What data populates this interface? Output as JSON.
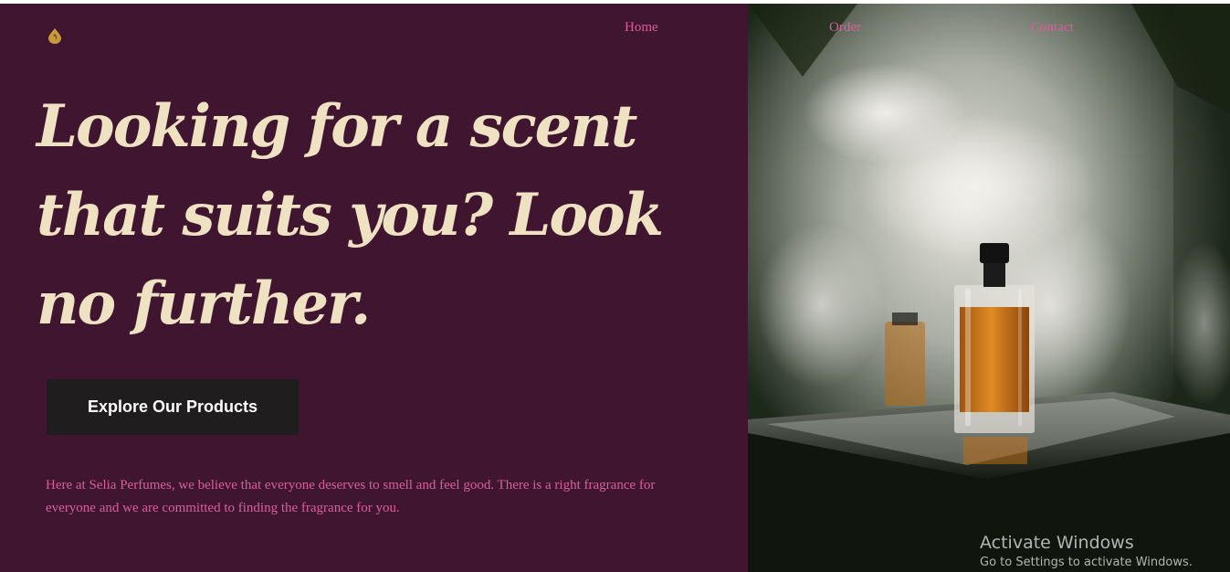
{
  "brand": {
    "logo_icon": "flame-drop-icon",
    "accent": "#c79a3a"
  },
  "nav": {
    "home_label": "Home",
    "order_label": "Order",
    "contact_label": "Contact"
  },
  "hero": {
    "headline": "Looking for a scent that suits you? Look no further.",
    "cta_label": "Explore Our Products",
    "description": "Here at Selia Perfumes, we believe that everyone deserves to smell and feel good. There is a right fragrance for everyone and we are committed to finding the fragrance for you."
  },
  "colors": {
    "background": "#401530",
    "headline": "#efe2c3",
    "link_pink": "#d7609a",
    "button": "#1f1d1e"
  },
  "watermark": {
    "title": "Activate Windows",
    "subtitle": "Go to Settings to activate Windows."
  }
}
